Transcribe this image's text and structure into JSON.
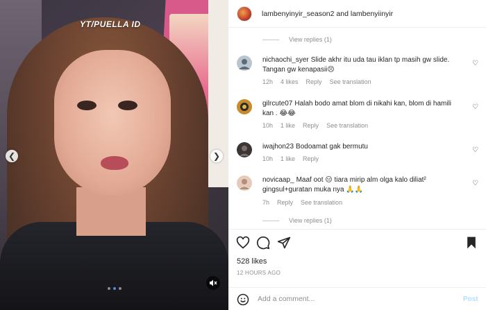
{
  "media": {
    "watermark": "YT/PUELLA ID",
    "prev_icon": "chevron-left-icon",
    "next_icon": "chevron-right-icon",
    "mute_icon": "speaker-muted-icon",
    "carousel_dots": 3,
    "active_dot": 2
  },
  "header": {
    "user1": "lambenyinyir_season2",
    "and": "and",
    "user2": "lambenyiinyir"
  },
  "replies_top": {
    "label": "View replies (1)"
  },
  "comments": [
    {
      "user": "nichaochi_syer",
      "text": "Slide akhr itu uda tau iklan tp masih gw slide. Tangan gw kenapasii😣",
      "time": "12h",
      "likes": "4 likes",
      "reply": "Reply",
      "translate": "See translation",
      "avatar_color": "#8aa4b8"
    },
    {
      "user": "gilrcute07",
      "text": "Halah bodo amat blom di nikahi kan, blom di hamili kan . 😂😂",
      "time": "10h",
      "likes": "1 like",
      "reply": "Reply",
      "translate": "See translation",
      "avatar_color": "#c58b2e"
    },
    {
      "user": "iwajhon23",
      "text": "Bodoamat gak bermutu",
      "time": "10h",
      "likes": "1 like",
      "reply": "Reply",
      "avatar_color": "#2e2a2a"
    },
    {
      "user": "novicaap_",
      "text": "Maaf oot 😑 tiara mirip alm olga kalo diliat² gingsul+guratan muka nya 🙏🙏",
      "time": "7h",
      "reply": "Reply",
      "translate": "See translation",
      "avatar_color": "#d7b8a6"
    }
  ],
  "replies_bottom": {
    "label": "View replies (1)"
  },
  "actions": {
    "like_icon": "heart-icon",
    "comment_icon": "comment-icon",
    "share_icon": "paper-plane-icon",
    "save_icon": "bookmark-icon"
  },
  "likes_count": "528 likes",
  "time_ago": "12 HOURS AGO",
  "add_comment": {
    "placeholder": "Add a comment...",
    "post_label": "Post",
    "emoji_icon": "smiley-icon"
  },
  "colors": {
    "text": "#262626",
    "muted": "#8e8e8e",
    "post_disabled": "#b2dffc",
    "divider": "#efefef"
  }
}
